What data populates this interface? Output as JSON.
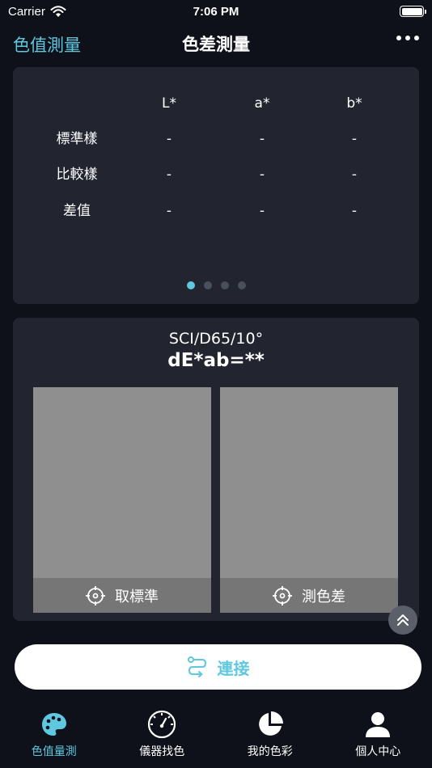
{
  "status_bar": {
    "carrier": "Carrier",
    "time": "7:06 PM"
  },
  "nav": {
    "back_label": "色值測量",
    "title": "色差測量"
  },
  "measurement_table": {
    "headers": [
      "",
      "L*",
      "a*",
      "b*"
    ],
    "rows": [
      {
        "label": "標準樣",
        "L": "-",
        "a": "-",
        "b": "-"
      },
      {
        "label": "比較樣",
        "L": "-",
        "a": "-",
        "b": "-"
      },
      {
        "label": "差值",
        "L": "-",
        "a": "-",
        "b": "-"
      }
    ],
    "page_dots": 4,
    "active_dot": 1
  },
  "swatch_panel": {
    "condition": "SCI/D65/10°",
    "delta_e": "dE*ab=**",
    "standard_button": "取標準",
    "measure_button": "測色差",
    "swatch_color": "#8f8f8f"
  },
  "connect": {
    "label": "連接"
  },
  "tabs": [
    {
      "label": "色值量測",
      "icon": "palette-icon",
      "active": true
    },
    {
      "label": "儀器找色",
      "icon": "gauge-icon",
      "active": false
    },
    {
      "label": "我的色彩",
      "icon": "pie-chart-icon",
      "active": false
    },
    {
      "label": "個人中心",
      "icon": "user-icon",
      "active": false
    }
  ],
  "colors": {
    "accent": "#5ec8e0",
    "background": "#0e1119",
    "card": "#222530"
  }
}
